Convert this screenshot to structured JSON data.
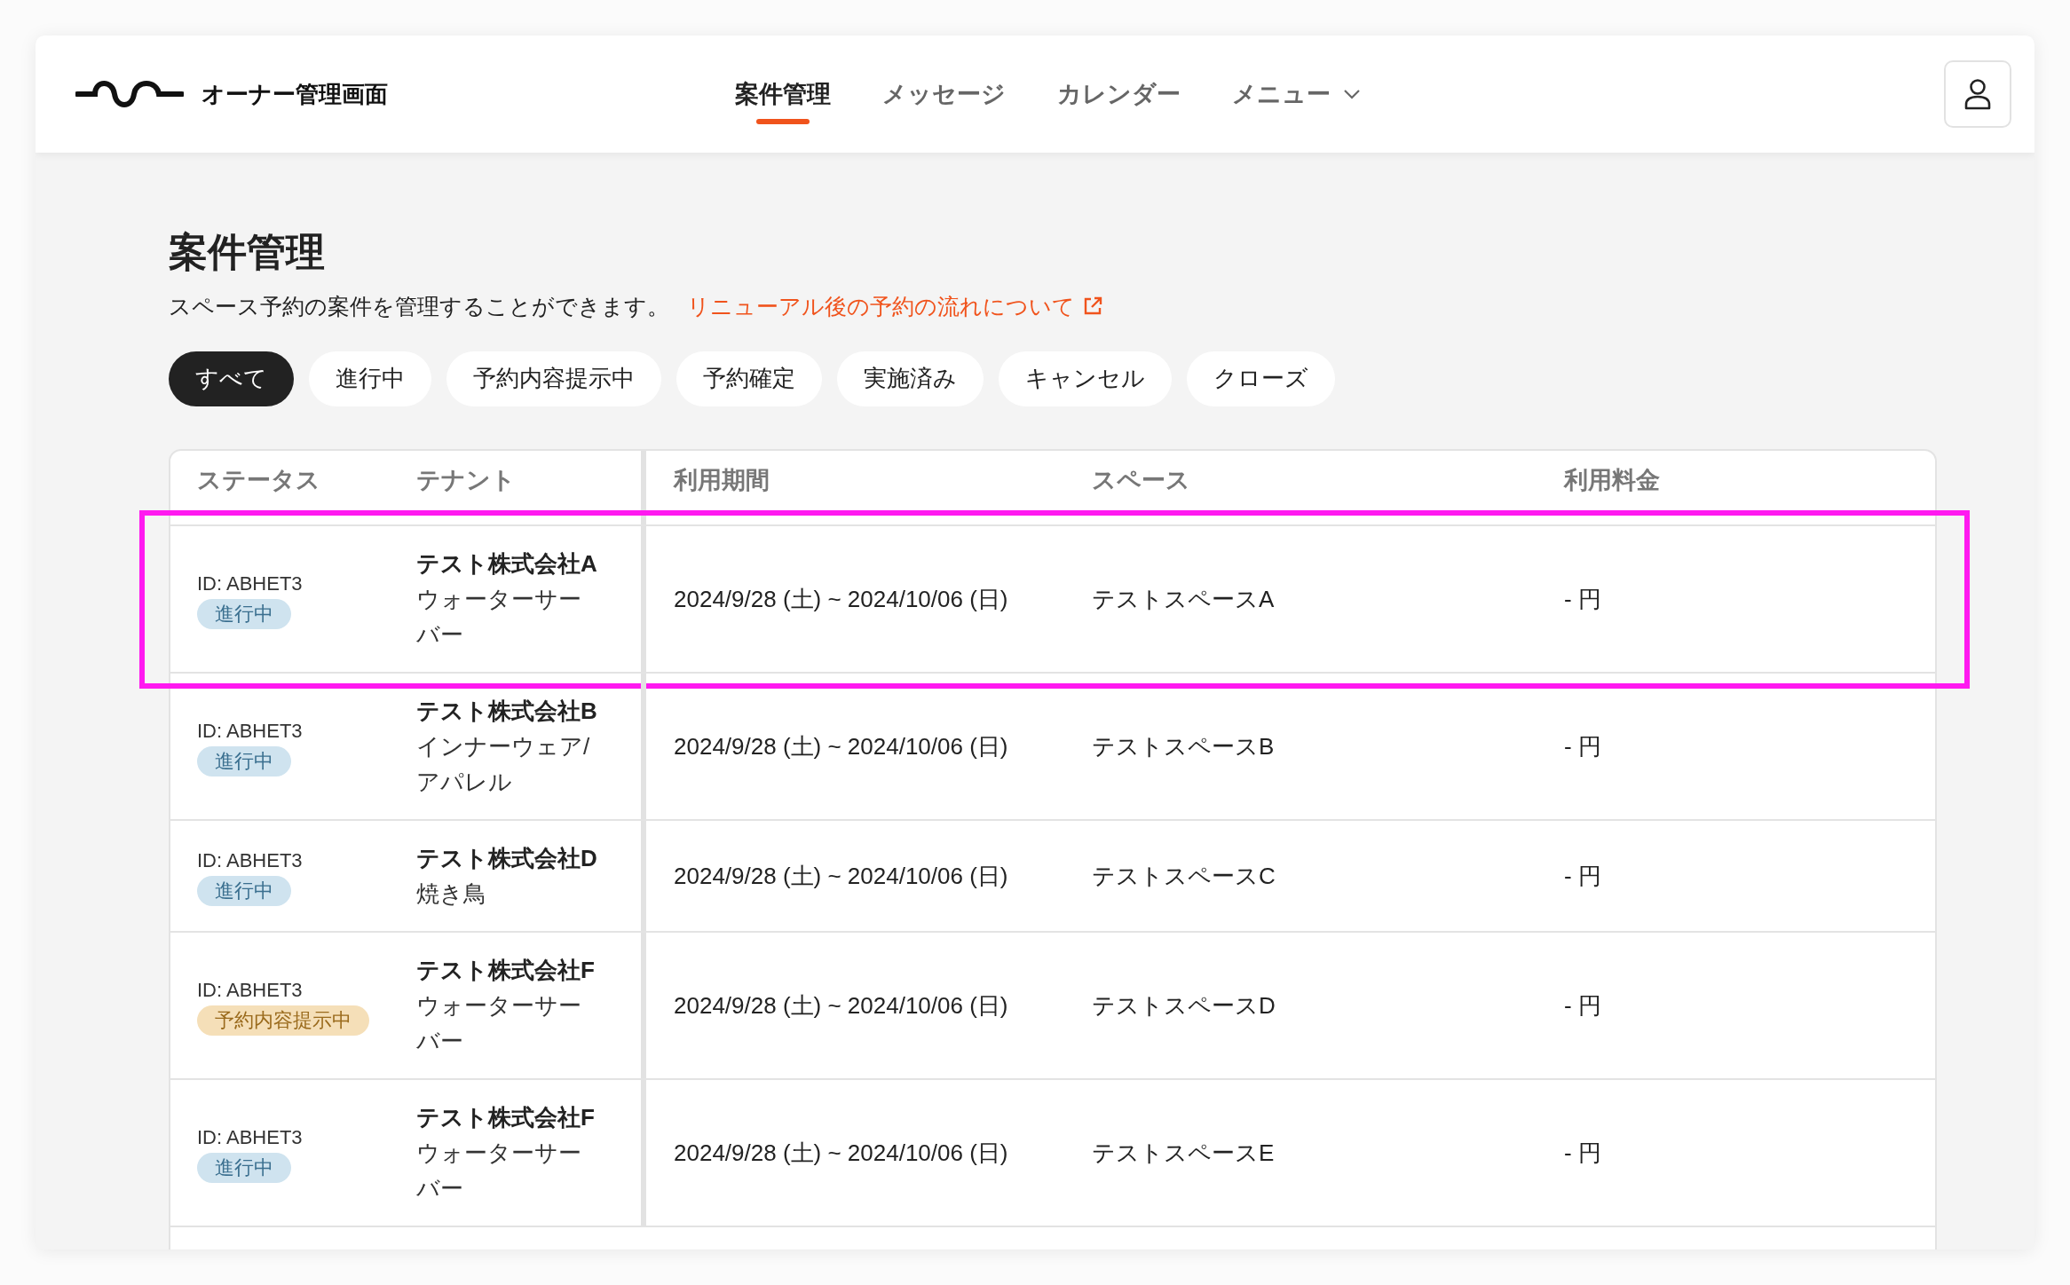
{
  "header": {
    "logo_text": "オーナー管理画面",
    "nav": [
      {
        "label": "案件管理",
        "selected": true,
        "kind": "link"
      },
      {
        "label": "メッセージ",
        "selected": false,
        "kind": "link"
      },
      {
        "label": "カレンダー",
        "selected": false,
        "kind": "link"
      },
      {
        "label": "メニュー",
        "selected": false,
        "kind": "dropdown"
      }
    ]
  },
  "page": {
    "title": "案件管理",
    "description": "スペース予約の案件を管理することができます。",
    "link": "リニューアル後の予約の流れについて"
  },
  "filters": [
    {
      "label": "すべて",
      "selected": true
    },
    {
      "label": "進行中",
      "selected": false
    },
    {
      "label": "予約内容提示中",
      "selected": false
    },
    {
      "label": "予約確定",
      "selected": false
    },
    {
      "label": "実施済み",
      "selected": false
    },
    {
      "label": "キャンセル",
      "selected": false
    },
    {
      "label": "クローズ",
      "selected": false
    }
  ],
  "table": {
    "columns": [
      "ステータス",
      "テナント",
      "利用期間",
      "スペース",
      "利用料金"
    ],
    "rows": [
      {
        "id": "ID: ABHET3",
        "status": {
          "label": "進行中",
          "kind": "in_progress"
        },
        "tenant_name": "テスト株式会社A",
        "tenant_category": "ウォーターサーバー",
        "period": "2024/9/28 (土) ~ 2024/10/06 (日)",
        "space": "テストスペースA",
        "fee": "- 円",
        "highlighted": true
      },
      {
        "id": "ID: ABHET3",
        "status": {
          "label": "進行中",
          "kind": "in_progress"
        },
        "tenant_name": "テスト株式会社B",
        "tenant_category": "インナーウェア/アパレル",
        "period": "2024/9/28 (土) ~ 2024/10/06 (日)",
        "space": "テストスペースB",
        "fee": "- 円",
        "highlighted": false
      },
      {
        "id": "ID: ABHET3",
        "status": {
          "label": "進行中",
          "kind": "in_progress"
        },
        "tenant_name": "テスト株式会社D",
        "tenant_category": "焼き鳥",
        "period": "2024/9/28 (土) ~ 2024/10/06 (日)",
        "space": "テストスペースC",
        "fee": "- 円",
        "highlighted": false
      },
      {
        "id": "ID: ABHET3",
        "status": {
          "label": "予約内容提示中",
          "kind": "proposal"
        },
        "tenant_name": "テスト株式会社F",
        "tenant_category": "ウォーターサーバー",
        "period": "2024/9/28 (土) ~ 2024/10/06 (日)",
        "space": "テストスペースD",
        "fee": "- 円",
        "highlighted": false
      },
      {
        "id": "ID: ABHET3",
        "status": {
          "label": "進行中",
          "kind": "in_progress"
        },
        "tenant_name": "テスト株式会社F",
        "tenant_category": "ウォーターサーバー",
        "period": "2024/9/28 (土) ~ 2024/10/06 (日)",
        "space": "テストスペースE",
        "fee": "- 円",
        "highlighted": false
      }
    ]
  }
}
